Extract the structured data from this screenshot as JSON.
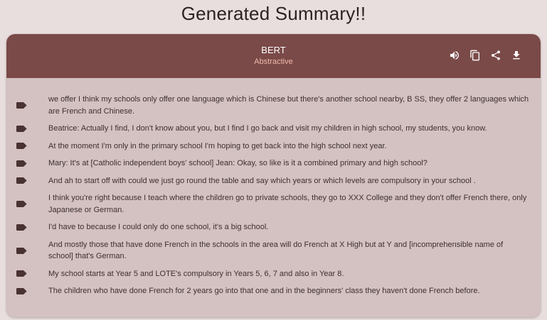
{
  "page": {
    "title": "Generated Summary!!"
  },
  "card": {
    "model_name": "BERT",
    "model_type": "Abstractive",
    "actions": [
      {
        "name": "speaker-icon"
      },
      {
        "name": "copy-icon"
      },
      {
        "name": "share-icon"
      },
      {
        "name": "download-icon"
      }
    ]
  },
  "colors": {
    "header_bg": "#7a4a48",
    "card_bg": "#d4c1c1",
    "page_bg": "#e9dede",
    "subtitle": "#f0b7a8"
  },
  "summary": {
    "items": [
      "we offer I think my schools only offer one language which is Chinese but there's another school nearby, B SS, they offer 2 languages which are French and Chinese.",
      "Beatrice: Actually I find, I don't know about you, but I find I go back and visit my children in high school, my students, you know.",
      "At the moment I'm only in the primary school I'm hoping to get back into the high school next year.",
      "Mary: It's at [Catholic independent boys' school] Jean: Okay, so like is it a combined primary and high school?",
      "And ah to start off with could we just go round the table and say which years or which levels are compulsory in your school .",
      "I think you're right because I teach where the children go to private schools, they go to XXX College and they don't offer French there, only Japanese or German.",
      "I'd have to because I could only do one school, it's a big school.",
      "And mostly those that have done French in the schools in the area will do French at X High but at Y and [incomprehensible name of school] that's German.",
      "My school starts at Year 5 and LOTE's compulsory in Years 5, 6, 7 and also in Year 8.",
      "The children who have done French for 2 years go into that one and in the beginners' class they haven't done French before."
    ]
  }
}
